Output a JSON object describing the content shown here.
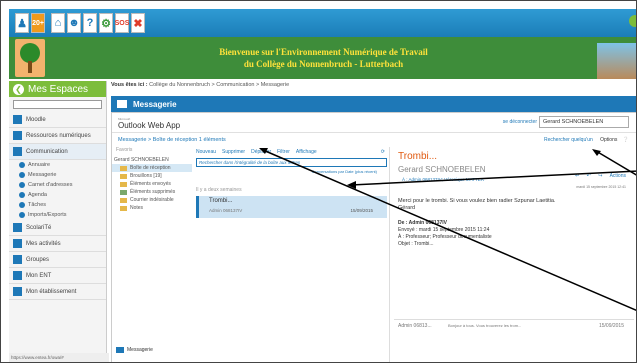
{
  "top": {
    "banner_line1": "Bienvenue sur l'Environnement Numérique de Travail",
    "banner_line2": "du Collège du Nonnenbruch - Lutterbach"
  },
  "sidebar": {
    "title": "Mes Espaces",
    "items": [
      {
        "label": "Moodle"
      },
      {
        "label": "Ressources numériques"
      },
      {
        "label": "Communication"
      }
    ],
    "subitems": [
      "Annuaire",
      "Messagerie",
      "Carnet d'adresses",
      "Agenda",
      "Tâches",
      "Imports/Exports"
    ],
    "items2": [
      "ScolariTé",
      "Mes activités",
      "Groupes",
      "Mon ENT",
      "Mon établissement"
    ],
    "status_url": "https://www.entea.fr/owa/#"
  },
  "breadcrumb": {
    "prefix": "Vous êtes ici :",
    "path": "Collège du Nonnenbruch > Communication > Messagerie"
  },
  "messagerie": {
    "title": "Messagerie"
  },
  "owa": {
    "logo": "Outlook Web App",
    "logo_small": "Microsoft",
    "disconnect": "se déconnecter",
    "user": "Gerard SCHNOEBELEN",
    "breadcrumb": "Messagerie > Boîte de réception 1 éléments",
    "search_people": "Rechercher quelqu'un",
    "options": "Options",
    "favoris": "Favoris",
    "folders": [
      {
        "name": "Gerard SCHNOEBELEN"
      },
      {
        "name": "Boîte de réception"
      },
      {
        "name": "Brouillons [19]"
      },
      {
        "name": "Éléments envoyés"
      },
      {
        "name": "Éléments supprimés"
      },
      {
        "name": "Courrier indésirable"
      },
      {
        "name": "Notes"
      }
    ],
    "toolbar": [
      "Nouveau",
      "Supprimer",
      "Déplacer",
      "Filtrer",
      "Affichage"
    ],
    "search_placeholder": "Rechercher dans l'intégralité de la boîte aux lettres",
    "sort_label": "Conversations par Date (plus récent)",
    "group_label": "Il y a deux semaines",
    "message": {
      "subject": "Trombi...",
      "from": "Admin 068137IV",
      "date": "15/09/2015"
    },
    "bottom_button": "Messagerie"
  },
  "reading": {
    "subject": "Trombi...",
    "from": "Gerard SCHNOEBELEN",
    "to": "À : Admin 068137IV; Véronique MATTER",
    "actions": "Actions",
    "date": "mardi 15 septembre 2015 12:41",
    "body1": "Merci pour le trombi. Si vous voulez bien radier Szpunar Laetitia.",
    "body2": "Gérard",
    "orig_from": "De : Admin 068137IV",
    "orig_sent": "Envoyé : mardi 15 septembre 2015 11:24",
    "orig_to": "À : Professeur; Professeur documentaliste",
    "orig_subj": "Objet : Trombi...",
    "thread_from": "Admin 06813...",
    "thread_body": "Bonjour à tous. Vous trouverez les trom...",
    "thread_date": "15/09/2015"
  }
}
